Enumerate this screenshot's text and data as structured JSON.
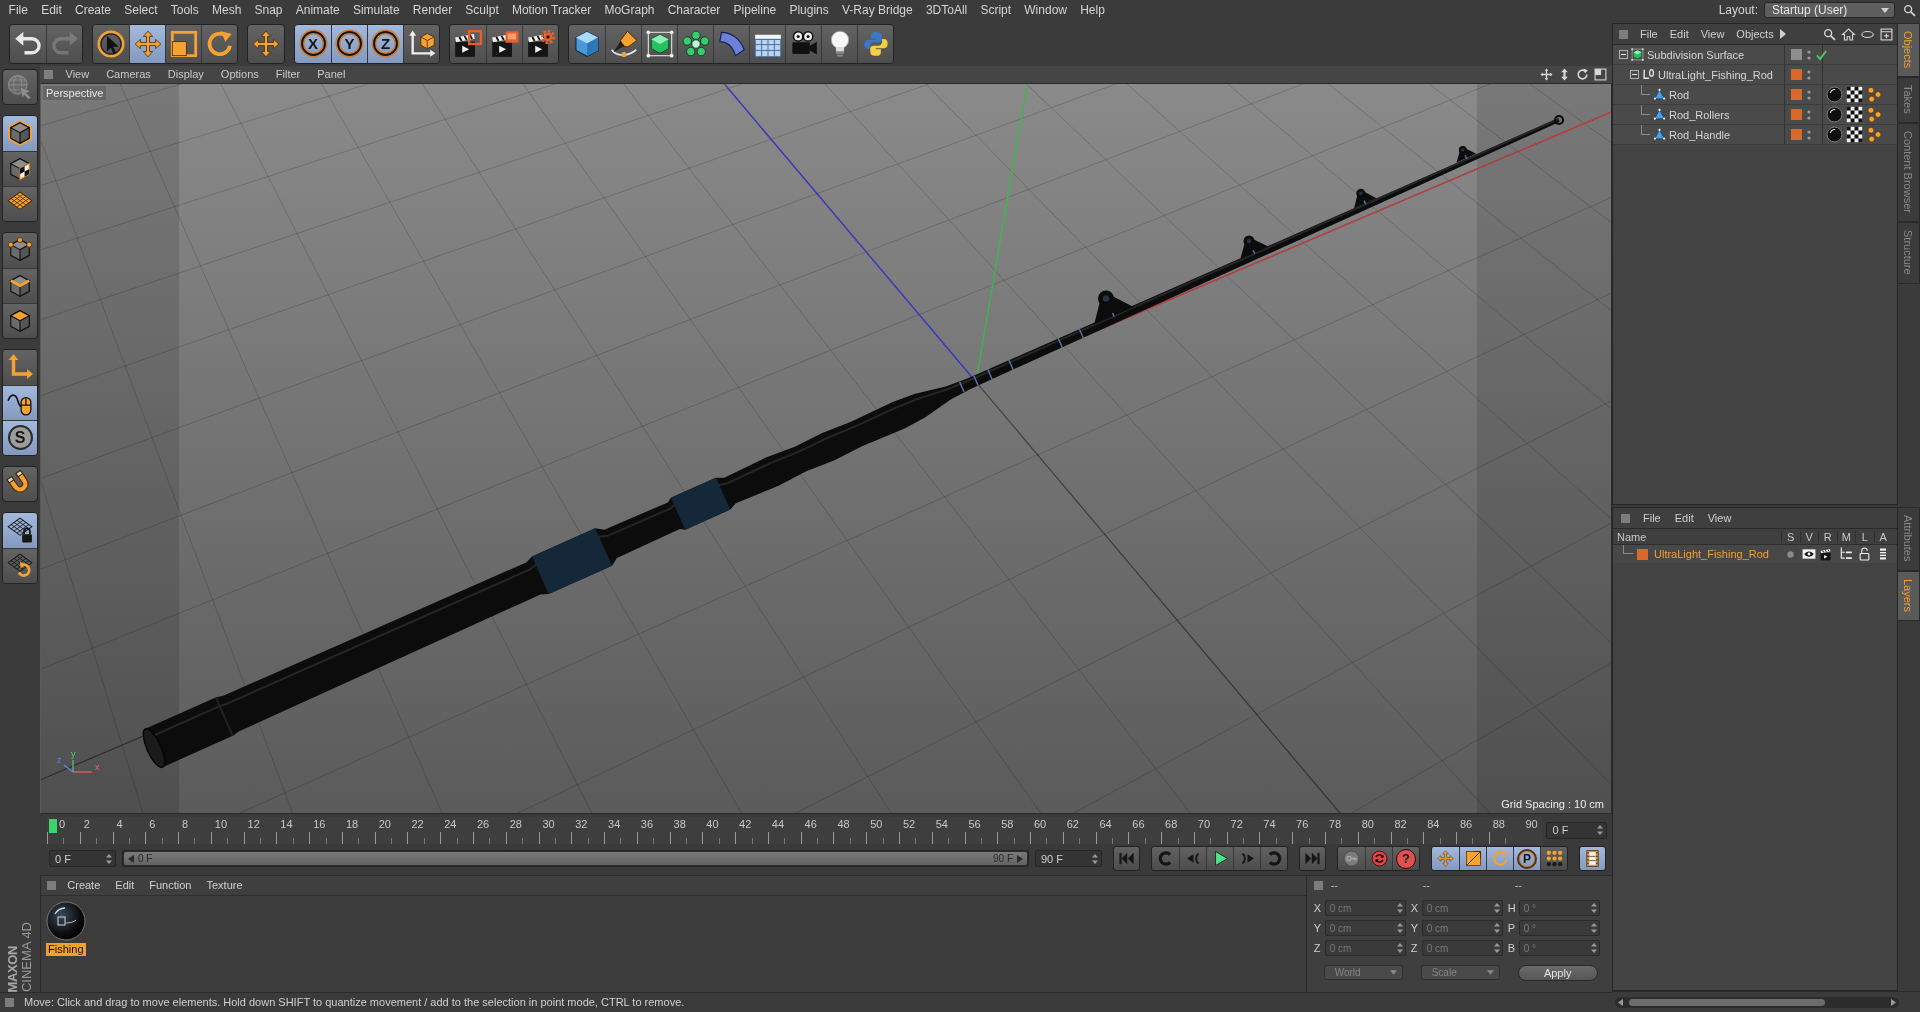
{
  "menu_bar": {
    "items": [
      "File",
      "Edit",
      "Create",
      "Select",
      "Tools",
      "Mesh",
      "Snap",
      "Animate",
      "Simulate",
      "Render",
      "Sculpt",
      "Motion Tracker",
      "MoGraph",
      "Character",
      "Pipeline",
      "Plugins",
      "V-Ray Bridge",
      "3DToAll",
      "Script",
      "Window",
      "Help"
    ],
    "layout": {
      "label": "Layout:",
      "value": "Startup (User)"
    }
  },
  "toolbar": {
    "groups": [
      {
        "tools": [
          {
            "kind": "undo",
            "disabled": false
          },
          {
            "kind": "redo",
            "disabled": true
          }
        ]
      },
      {
        "tools": [
          {
            "kind": "live-select",
            "selected": false
          },
          {
            "kind": "move",
            "selected": true
          },
          {
            "kind": "scale",
            "selected": false
          },
          {
            "kind": "rotate",
            "selected": false
          }
        ]
      },
      {
        "tools": [
          {
            "kind": "recent-move",
            "selected": false
          }
        ]
      },
      {
        "tools": [
          {
            "kind": "axis",
            "label": "X",
            "selected": true
          },
          {
            "kind": "axis",
            "label": "Y",
            "selected": true
          },
          {
            "kind": "axis",
            "label": "Z",
            "selected": true
          },
          {
            "kind": "coordinate-system",
            "selected": false
          }
        ]
      },
      {
        "tools": [
          {
            "kind": "render-view"
          },
          {
            "kind": "render-picture"
          },
          {
            "kind": "render-settings"
          }
        ]
      },
      {
        "tools": [
          {
            "kind": "cube"
          },
          {
            "kind": "pen"
          },
          {
            "kind": "subdivision"
          },
          {
            "kind": "cloner"
          },
          {
            "kind": "bend"
          },
          {
            "kind": "floor"
          },
          {
            "kind": "camera"
          },
          {
            "kind": "light"
          },
          {
            "kind": "python"
          }
        ]
      }
    ]
  },
  "left_toolbar": {
    "groups": [
      {
        "tools": [
          {
            "kind": "convert",
            "disabled": true
          }
        ]
      },
      {
        "tools": [
          {
            "kind": "model",
            "selected": true
          },
          {
            "kind": "texture",
            "selected": false
          },
          {
            "kind": "workplane",
            "selected": false
          }
        ]
      },
      {
        "tools": [
          {
            "kind": "points",
            "selected": false
          },
          {
            "kind": "edges",
            "selected": false
          },
          {
            "kind": "polygons",
            "selected": false
          }
        ]
      },
      {
        "tools": [
          {
            "kind": "axis-mode",
            "selected": false
          },
          {
            "kind": "tweak",
            "selected": true
          },
          {
            "kind": "snap",
            "label": "S",
            "selected": true
          }
        ]
      },
      {
        "tools": [
          {
            "kind": "magnet",
            "selected": false
          }
        ]
      },
      {
        "tools": [
          {
            "kind": "workplane-lock",
            "selected": true
          },
          {
            "kind": "workplane-align",
            "selected": false
          }
        ]
      }
    ]
  },
  "viewport": {
    "menu": [
      "View",
      "Cameras",
      "Display",
      "Options",
      "Filter",
      "Panel"
    ],
    "camera": "Perspective",
    "grid_spacing": "Grid Spacing : 10 cm",
    "gizmo_labels": [
      "z",
      "y",
      "x"
    ]
  },
  "timeline": {
    "ticks": [
      "0",
      "2",
      "4",
      "6",
      "8",
      "10",
      "12",
      "14",
      "16",
      "18",
      "20",
      "22",
      "24",
      "26",
      "28",
      "30",
      "32",
      "34",
      "36",
      "38",
      "40",
      "42",
      "44",
      "46",
      "48",
      "50",
      "52",
      "54",
      "56",
      "58",
      "60",
      "62",
      "64",
      "66",
      "68",
      "70",
      "72",
      "74",
      "76",
      "78",
      "80",
      "82",
      "84",
      "86",
      "88",
      "90"
    ],
    "level": 0,
    "current_frame": "0 F",
    "start_field": "0 F",
    "range": {
      "start": "0 F",
      "end": "90 F",
      "level": 1
    },
    "end_field": "90 F",
    "controls": {
      "groups": [
        {
          "tools": [
            {
              "kind": "first"
            }
          ]
        },
        {
          "tools": [
            {
              "kind": "prev-key"
            },
            {
              "kind": "prev-frame"
            },
            {
              "kind": "play"
            },
            {
              "kind": "next-frame"
            },
            {
              "kind": "next-key"
            }
          ]
        },
        {
          "tools": [
            {
              "kind": "last"
            }
          ]
        },
        {
          "tools": [
            {
              "kind": "record"
            },
            {
              "kind": "autokey"
            },
            {
              "kind": "key-selection",
              "label": "?"
            }
          ]
        },
        {
          "tools": [
            {
              "kind": "position",
              "selected": true
            },
            {
              "kind": "scale-key",
              "selected": true
            },
            {
              "kind": "rotation-key",
              "selected": true
            },
            {
              "kind": "parameter",
              "label": "P",
              "selected": true
            },
            {
              "kind": "pla",
              "selected": false
            }
          ]
        },
        {
          "tools": [
            {
              "kind": "timeline",
              "selected": true
            }
          ]
        }
      ]
    }
  },
  "material_manager": {
    "menu": [
      "Create",
      "Edit",
      "Function",
      "Texture"
    ],
    "materials": [
      {
        "name": "Fishing",
        "selected": true
      }
    ]
  },
  "coordinates": {
    "headers": [
      "--",
      "--",
      "--"
    ],
    "disabled": true,
    "rows": [
      {
        "cells": [
          {
            "label": "X",
            "value": "0 cm"
          },
          {
            "label": "X",
            "value": "0 cm"
          },
          {
            "label": "H",
            "value": "0 °"
          }
        ]
      },
      {
        "cells": [
          {
            "label": "Y",
            "value": "0 cm"
          },
          {
            "label": "Y",
            "value": "0 cm"
          },
          {
            "label": "P",
            "value": "0 °"
          }
        ]
      },
      {
        "cells": [
          {
            "label": "Z",
            "value": "0 cm"
          },
          {
            "label": "Z",
            "value": "0 cm"
          },
          {
            "label": "B",
            "value": "0 °"
          }
        ]
      }
    ],
    "dropdowns": [
      "World",
      "Scale"
    ],
    "apply": "Apply"
  },
  "logo": {
    "brand": "MAXON",
    "product": "CINEMA 4D"
  },
  "status_bar": {
    "text": "Move: Click and drag to move elements. Hold down SHIFT to quantize movement / add to the selection in point mode, CTRL to remove."
  },
  "object_manager": {
    "menu": [
      "File",
      "Edit",
      "View",
      "Objects"
    ],
    "objects": [
      {
        "name": "Subdivision Surface",
        "kind": "subdivision",
        "expanded": true,
        "color": "#8e8e8e",
        "check": true,
        "children": [
          {
            "name": "UltraLight_Fishing_Rod",
            "kind": "null",
            "expanded": true,
            "color": "#d9692a",
            "check": false,
            "children": [
              {
                "name": "Rod",
                "kind": "polygon",
                "color": "#d9692a",
                "check": false,
                "tags": [
                  {
                    "kind": "material"
                  },
                  {
                    "kind": "uvw"
                  },
                  {
                    "kind": "selection"
                  }
                ]
              },
              {
                "name": "Rod_Rollers",
                "kind": "polygon",
                "color": "#d9692a",
                "check": false,
                "tags": [
                  {
                    "kind": "material"
                  },
                  {
                    "kind": "uvw"
                  },
                  {
                    "kind": "selection"
                  }
                ]
              },
              {
                "name": "Rod_Handle",
                "kind": "polygon",
                "color": "#d9692a",
                "check": false,
                "tags": [
                  {
                    "kind": "material"
                  },
                  {
                    "kind": "uvw"
                  },
                  {
                    "kind": "selection"
                  }
                ]
              }
            ]
          }
        ]
      }
    ]
  },
  "layer_manager": {
    "menu": [
      "File",
      "Edit",
      "View"
    ],
    "columns": [
      "Name",
      "S",
      "V",
      "R",
      "M",
      "L",
      "A"
    ],
    "layers": [
      {
        "name": "UltraLight_Fishing_Rod",
        "color": "#d9692a",
        "selected": true,
        "solo": false,
        "visible": true,
        "render": true,
        "manager": true,
        "locked": false,
        "animation": true
      }
    ]
  },
  "side_tabs": {
    "upper": [
      {
        "label": "Objects",
        "selected": true
      },
      {
        "label": "Takes",
        "selected": false
      },
      {
        "label": "Content Browser",
        "selected": false
      },
      {
        "label": "Structure",
        "selected": false
      }
    ],
    "lower": [
      {
        "label": "Attributes",
        "selected": false
      },
      {
        "label": "Layers",
        "selected": true
      }
    ]
  }
}
